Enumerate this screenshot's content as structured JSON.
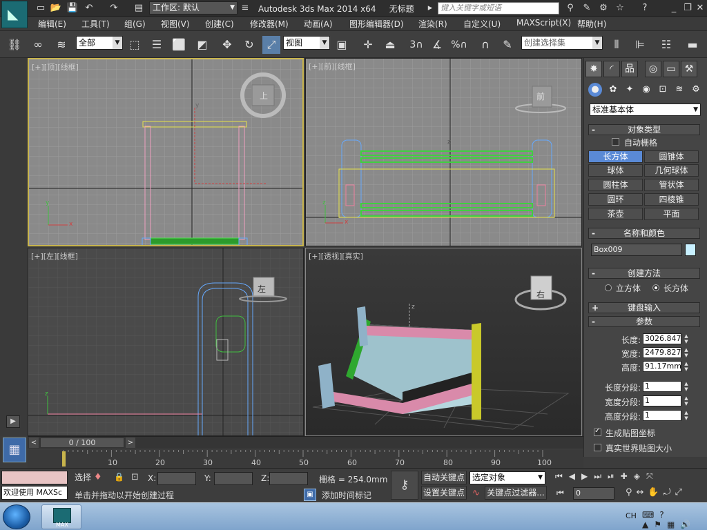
{
  "titlebar": {
    "workspace_label": "工作区: 默认",
    "app_title": "Autodesk 3ds Max  2014 x64",
    "doc_title": "无标题",
    "search_placeholder": "键入关键字或短语",
    "help_label": "?"
  },
  "menu": [
    "编辑(E)",
    "工具(T)",
    "组(G)",
    "视图(V)",
    "创建(C)",
    "修改器(M)",
    "动画(A)",
    "图形编辑器(D)",
    "渲染(R)",
    "自定义(U)",
    "MAXScript(X)",
    "帮助(H)"
  ],
  "toolbar": {
    "selection_filter": "全部",
    "ref_coord": "视图",
    "named_selection": "创建选择集",
    "snap_labels": [
      "3",
      "%"
    ]
  },
  "viewports": {
    "top": {
      "label": "[+][顶][线框]",
      "cube_label": "上"
    },
    "front": {
      "label": "[+][前][线框]",
      "cube_label": "前"
    },
    "left": {
      "label": "[+][左][线框]",
      "cube_label": "左"
    },
    "persp": {
      "label": "[+][透视][真实]",
      "cube_label": "右"
    }
  },
  "axis": {
    "x": "x",
    "y": "y",
    "z": "z"
  },
  "panel": {
    "category": "标准基本体",
    "object_type_title": "对象类型",
    "autogrid_label": "自动栅格",
    "autogrid_checked": false,
    "buttons": [
      "长方体",
      "圆锥体",
      "球体",
      "几何球体",
      "圆柱体",
      "管状体",
      "圆环",
      "四棱锥",
      "茶壶",
      "平面"
    ],
    "active_button": "长方体",
    "name_color_title": "名称和颜色",
    "object_name": "Box009",
    "object_color": "#c8f0ff",
    "creation_method_title": "创建方法",
    "creation_options": [
      "立方体",
      "长方体"
    ],
    "creation_selected": "长方体",
    "keyboard_entry_title": "键盘输入",
    "params_title": "参数",
    "params": [
      {
        "label": "长度:",
        "value": "3026.847"
      },
      {
        "label": "宽度:",
        "value": "2479.827"
      },
      {
        "label": "高度:",
        "value": "91.17mm"
      }
    ],
    "segments": [
      {
        "label": "长度分段:",
        "value": "1"
      },
      {
        "label": "宽度分段:",
        "value": "1"
      },
      {
        "label": "高度分段:",
        "value": "1"
      }
    ],
    "gen_map_label": "生成贴图坐标",
    "gen_map_checked": true,
    "real_world_label": "真实世界贴图大小",
    "real_world_checked": false,
    "collapse_sign": "-",
    "expand_sign": "+"
  },
  "timeline": {
    "position": "0 / 100",
    "ticks": [
      "10",
      "20",
      "30",
      "40",
      "50",
      "60",
      "70",
      "80",
      "90",
      "100"
    ],
    "prev": "<",
    "next": ">"
  },
  "status": {
    "welcome": "欢迎使用 MAXSc",
    "selected_label": "选择",
    "x_label": "X:",
    "y_label": "Y:",
    "z_label": "Z:",
    "grid_label": "栅格 = 254.0mm",
    "prompt": "单击并拖动以开始创建过程",
    "add_time_tag": "添加时间标记",
    "auto_key": "自动关键点",
    "set_key": "设置关键点",
    "key_mode": "选定对象",
    "key_filters": "关键点过滤器...",
    "frame_value": "0"
  },
  "taskbar": {
    "app_label": "MAX",
    "lang": "CH"
  }
}
